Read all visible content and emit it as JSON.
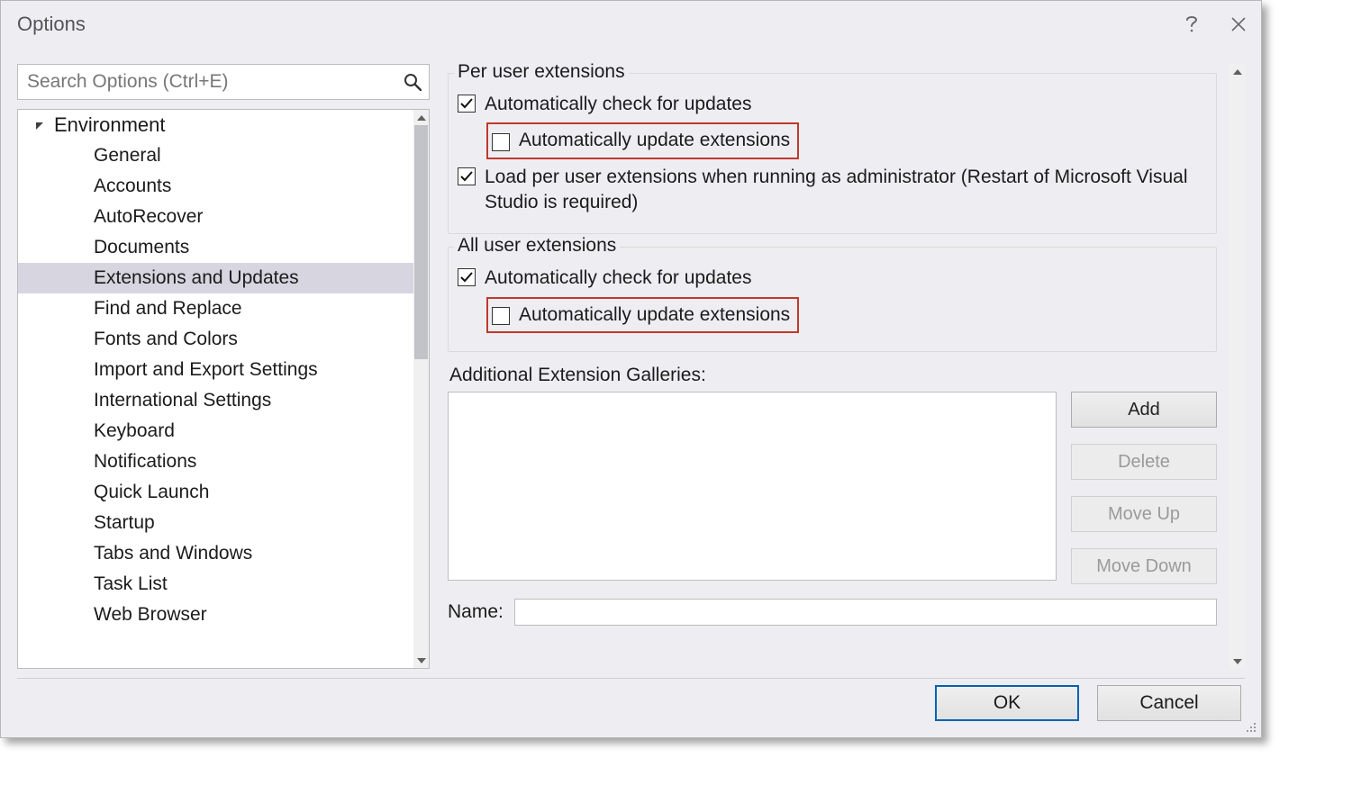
{
  "title": "Options",
  "search": {
    "placeholder": "Search Options (Ctrl+E)"
  },
  "tree": {
    "root": "Environment",
    "items": [
      "General",
      "Accounts",
      "AutoRecover",
      "Documents",
      "Extensions and Updates",
      "Find and Replace",
      "Fonts and Colors",
      "Import and Export Settings",
      "International Settings",
      "Keyboard",
      "Notifications",
      "Quick Launch",
      "Startup",
      "Tabs and Windows",
      "Task List",
      "Web Browser"
    ],
    "selected_index": 4
  },
  "groups": {
    "per_user": {
      "legend": "Per user extensions",
      "auto_check": "Automatically check for updates",
      "auto_update": "Automatically update extensions",
      "load_admin": "Load per user extensions when running as administrator (Restart of Microsoft Visual Studio is required)"
    },
    "all_user": {
      "legend": "All user extensions",
      "auto_check": "Automatically check for updates",
      "auto_update": "Automatically update extensions"
    }
  },
  "galleries": {
    "label": "Additional Extension Galleries:",
    "buttons": {
      "add": "Add",
      "delete": "Delete",
      "move_up": "Move Up",
      "move_down": "Move Down"
    },
    "name_label": "Name:",
    "name_value": ""
  },
  "footer": {
    "ok": "OK",
    "cancel": "Cancel"
  }
}
